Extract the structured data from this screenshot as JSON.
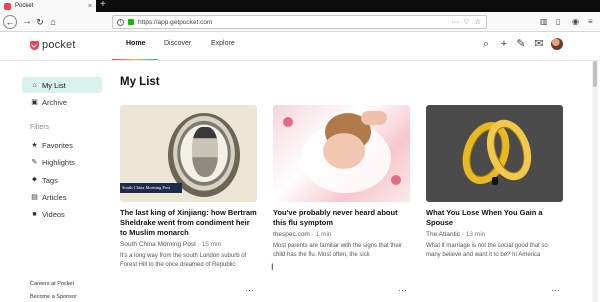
{
  "browser": {
    "tab_title": "Pocket",
    "tab_close": "×",
    "new_tab": "+",
    "url": "https://app.getpocket.com"
  },
  "header": {
    "logo_text": "pocket",
    "nav": [
      "Home",
      "Discover",
      "Explore"
    ],
    "active_nav": "Home"
  },
  "sidebar": {
    "items": [
      {
        "label": "My List",
        "icon": "home-icon",
        "active": true
      },
      {
        "label": "Archive",
        "icon": "archive-icon",
        "active": false
      }
    ],
    "filters_heading": "Filters",
    "filters": [
      {
        "label": "Favorites",
        "icon": "star-icon"
      },
      {
        "label": "Highlights",
        "icon": "highlighter-icon"
      },
      {
        "label": "Tags",
        "icon": "tag-icon"
      },
      {
        "label": "Articles",
        "icon": "article-icon"
      },
      {
        "label": "Videos",
        "icon": "video-icon"
      }
    ],
    "footer": [
      "Careers at Pocket",
      "Become a Sponsor"
    ]
  },
  "main": {
    "title": "My List",
    "cards": [
      {
        "title": "The last king of Xinjiang: how Bertram Sheldrake went from condiment heir to Muslim monarch",
        "source": "South China Morning Post",
        "time": "15 min",
        "excerpt": "It's a long way from the south London suburb of Forest Hill to the once dreamed of Republic",
        "image_caption": "South China Morning Post",
        "more": "···"
      },
      {
        "title": "You've probably never heard about this flu symptom",
        "source": "thespec.com",
        "time": "1 min",
        "excerpt": "Most parents are familiar with the signs that their child has the flu. Most often, the sick",
        "more": "···"
      },
      {
        "title": "What You Lose When You Gain a Spouse",
        "source": "The Atlantic",
        "time": "13 min",
        "excerpt": "What if marriage is not the social good that so many believe and want it to be? In America",
        "more": "···"
      }
    ]
  },
  "colors": {
    "accent": "#ef4056",
    "active_bg": "#d9f2ee"
  }
}
